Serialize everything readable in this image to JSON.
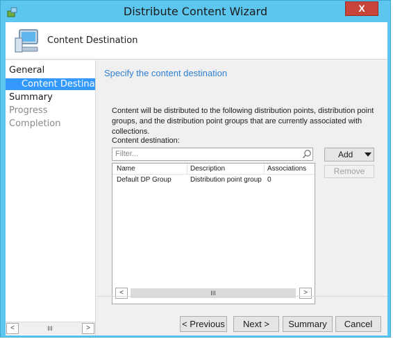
{
  "window": {
    "title": "Distribute Content Wizard",
    "close_label": "X"
  },
  "header": {
    "title": "Content Destination"
  },
  "nav": {
    "items": [
      {
        "label": "General"
      },
      {
        "label": "Content Destination"
      },
      {
        "label": "Summary"
      },
      {
        "label": "Progress"
      },
      {
        "label": "Completion"
      }
    ],
    "scroll_thumb": "III"
  },
  "main": {
    "heading": "Specify the content destination",
    "description": "Content will be distributed to the following distribution points, distribution point groups, and the distribution point groups that are currently associated with collections.",
    "content_destination_label": "Content destination:",
    "filter_placeholder": "Filter...",
    "add_button": "Add",
    "remove_button": "Remove",
    "table": {
      "columns": [
        "Name",
        "Description",
        "Associations"
      ],
      "rows": [
        [
          "Default DP Group",
          "Distribution point group",
          "0"
        ]
      ]
    },
    "hscroll_thumb": "III"
  },
  "footer": {
    "previous": "< Previous",
    "next": "Next >",
    "summary": "Summary",
    "cancel": "Cancel"
  },
  "colors": {
    "titlebar": "#5cc6ee",
    "selection": "#3399ff",
    "heading": "#2f7fd1",
    "close": "#c9443a"
  }
}
